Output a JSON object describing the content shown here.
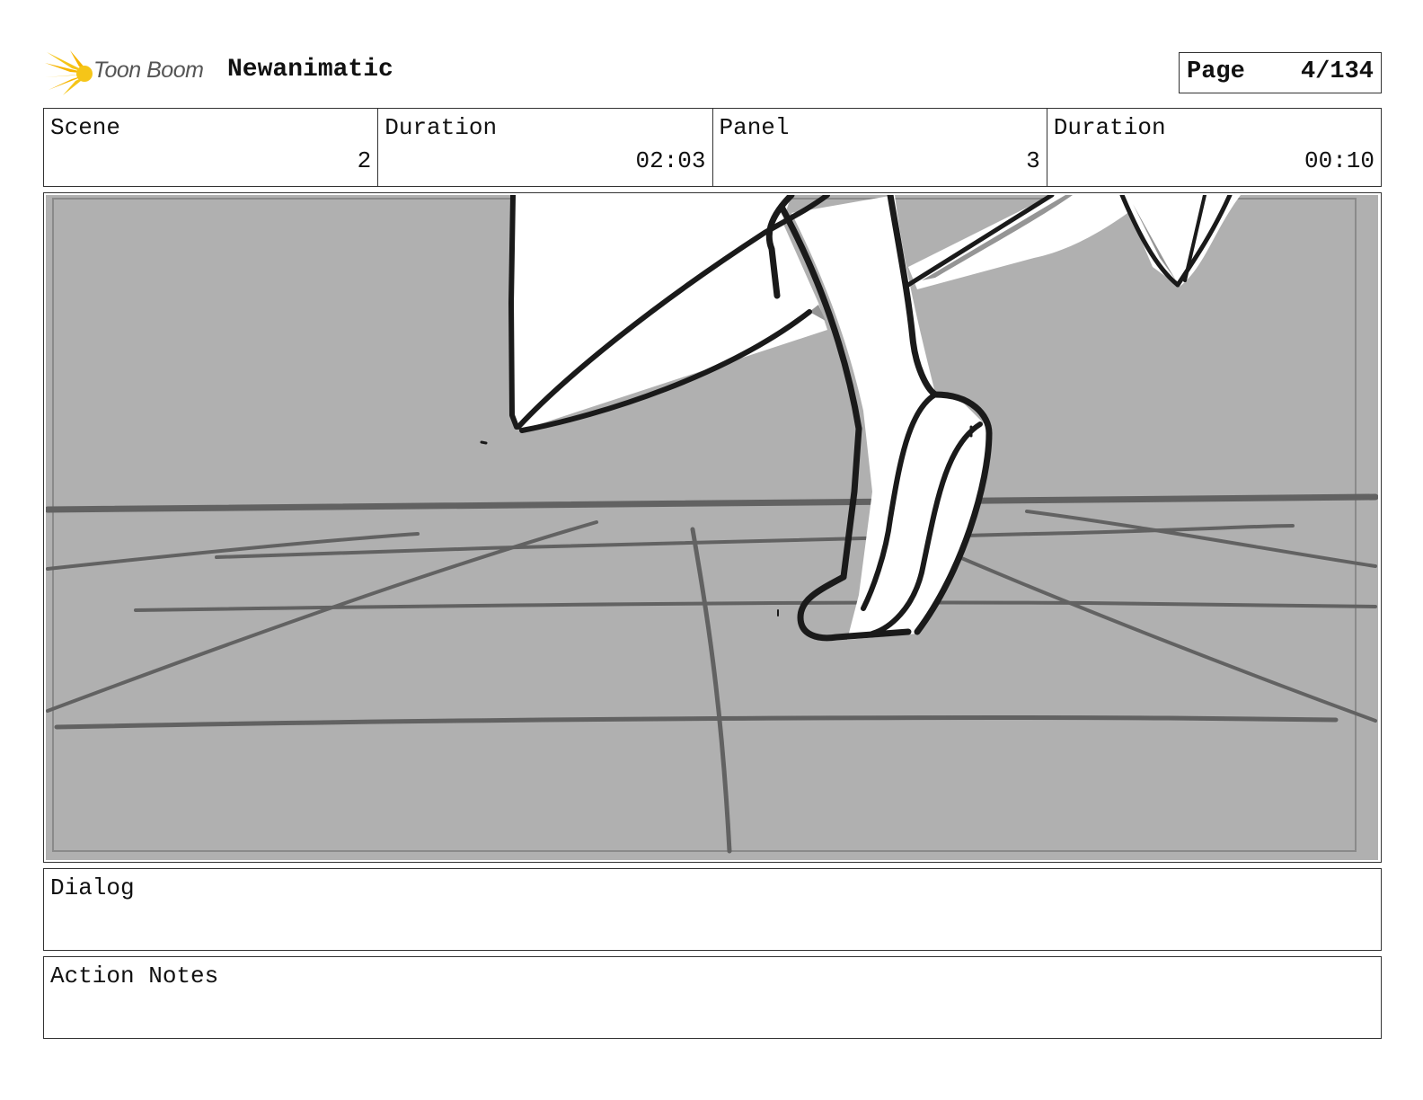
{
  "header": {
    "logo_text": "Toon Boom",
    "logo_icon": "sunburst-logo-icon",
    "project_title": "Newanimatic",
    "page_label": "Page",
    "page_number": "4/134"
  },
  "info": {
    "scene_label": "Scene",
    "scene_value": "2",
    "scene_duration_label": "Duration",
    "scene_duration_value": "02:03",
    "panel_label": "Panel",
    "panel_value": "3",
    "panel_duration_label": "Duration",
    "panel_duration_value": "00:10"
  },
  "boxes": {
    "dialog_label": "Dialog",
    "action_notes_label": "Action Notes"
  },
  "colors": {
    "logo_yellow": "#f5c518",
    "sketch_bg": "#b0b0b0",
    "floor_line": "#626262",
    "ink": "#1a1a1a"
  }
}
